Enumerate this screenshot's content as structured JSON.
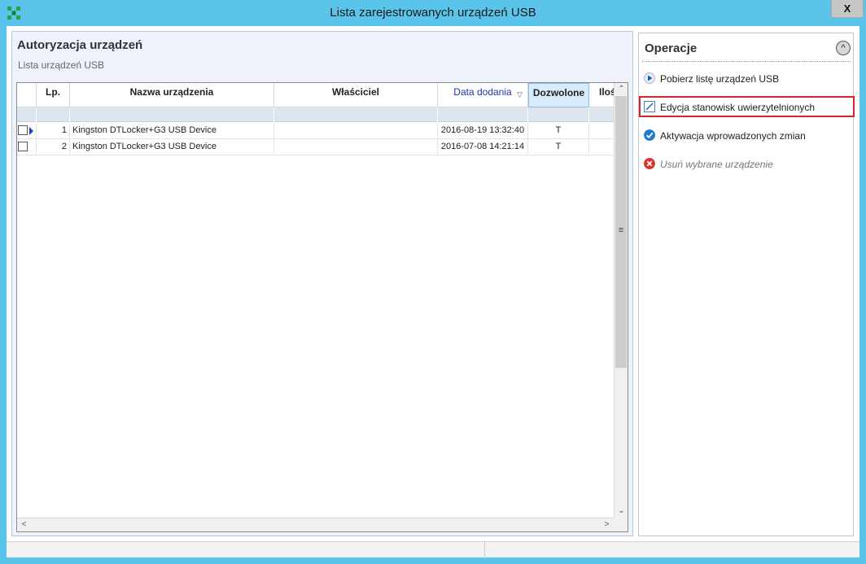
{
  "window": {
    "title": "Lista zarejestrowanych urządzeń USB",
    "close_label": "X"
  },
  "left_panel": {
    "title": "Autoryzacja urządzeń",
    "subtitle": "Lista urządzeń USB"
  },
  "grid": {
    "columns": [
      {
        "label": "Lp."
      },
      {
        "label": "Nazwa urządzenia"
      },
      {
        "label": "Właściciel"
      },
      {
        "label": "Data dodania"
      },
      {
        "label": "Dozwolone"
      },
      {
        "label": "Iloś"
      }
    ],
    "rows": [
      {
        "lp": "1",
        "name": "Kingston DTLocker+G3 USB Device",
        "owner": "",
        "date": "2016-08-19 13:32:40",
        "allowed": "T"
      },
      {
        "lp": "2",
        "name": "Kingston DTLocker+G3 USB Device",
        "owner": "",
        "date": "2016-07-08 14:21:14",
        "allowed": "T"
      }
    ],
    "scroll_up": "⌃",
    "scroll_down": "⌄",
    "scroll_left": "<",
    "scroll_right": ">",
    "grip": "≡"
  },
  "operations": {
    "title": "Operacje",
    "collapse_label": "^",
    "items": [
      {
        "label": "Pobierz listę urządzeń USB",
        "icon": "play-icon"
      },
      {
        "label": "Edycja stanowisk uwierzytelnionych",
        "icon": "edit-icon"
      },
      {
        "label": "Aktywacja wprowadzonych zmian",
        "icon": "check-icon"
      },
      {
        "label": "Usuń wybrane urządzenie",
        "icon": "delete-icon"
      }
    ]
  },
  "colors": {
    "titlebar": "#5bc4ea",
    "highlight": "#d9232d",
    "sorted_header": "#2233aa",
    "check_icon": "#1a7ccf",
    "delete_icon": "#d9342b"
  }
}
